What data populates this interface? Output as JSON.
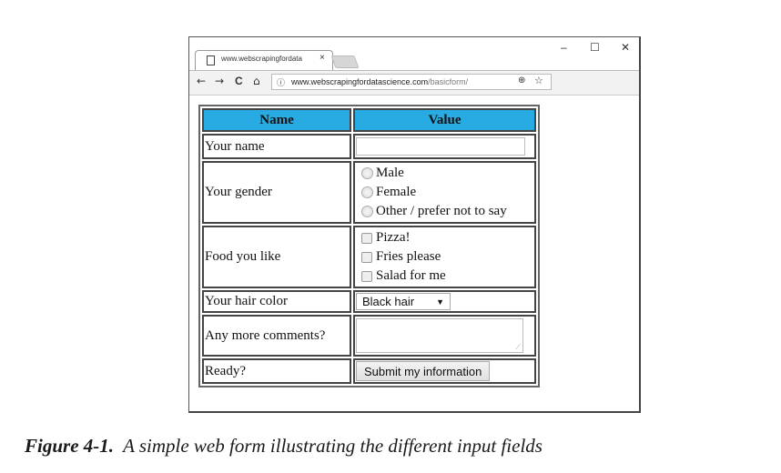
{
  "browser": {
    "tab_title": "www.webscrapingfordata",
    "tab_close": "×",
    "window_controls": {
      "minimize": "–",
      "maximize": "☐",
      "close": "✕"
    },
    "nav": {
      "back": "←",
      "forward": "→",
      "reload": "C",
      "home": "⌂"
    },
    "url_host": "www.webscrapingfordatascience.com",
    "url_path": "/basicform/",
    "icons": {
      "info": "ⓘ",
      "zoom": "⊕",
      "bookmark": "☆"
    }
  },
  "form": {
    "headers": {
      "name": "Name",
      "value": "Value"
    },
    "rows": {
      "name": {
        "label": "Your name",
        "value": ""
      },
      "gender": {
        "label": "Your gender",
        "options": [
          "Male",
          "Female",
          "Other / prefer not to say"
        ]
      },
      "food": {
        "label": "Food you like",
        "options": [
          "Pizza!",
          "Fries please",
          "Salad for me"
        ]
      },
      "hair": {
        "label": "Your hair color",
        "selected": "Black hair",
        "arrow": "▼"
      },
      "comments": {
        "label": "Any more comments?",
        "value": ""
      },
      "ready": {
        "label": "Ready?",
        "button": "Submit my information"
      }
    }
  },
  "caption": {
    "label": "Figure 4-1.",
    "text": "A simple web form illustrating the different input fields"
  },
  "colors": {
    "header_bg": "#27abe2"
  }
}
